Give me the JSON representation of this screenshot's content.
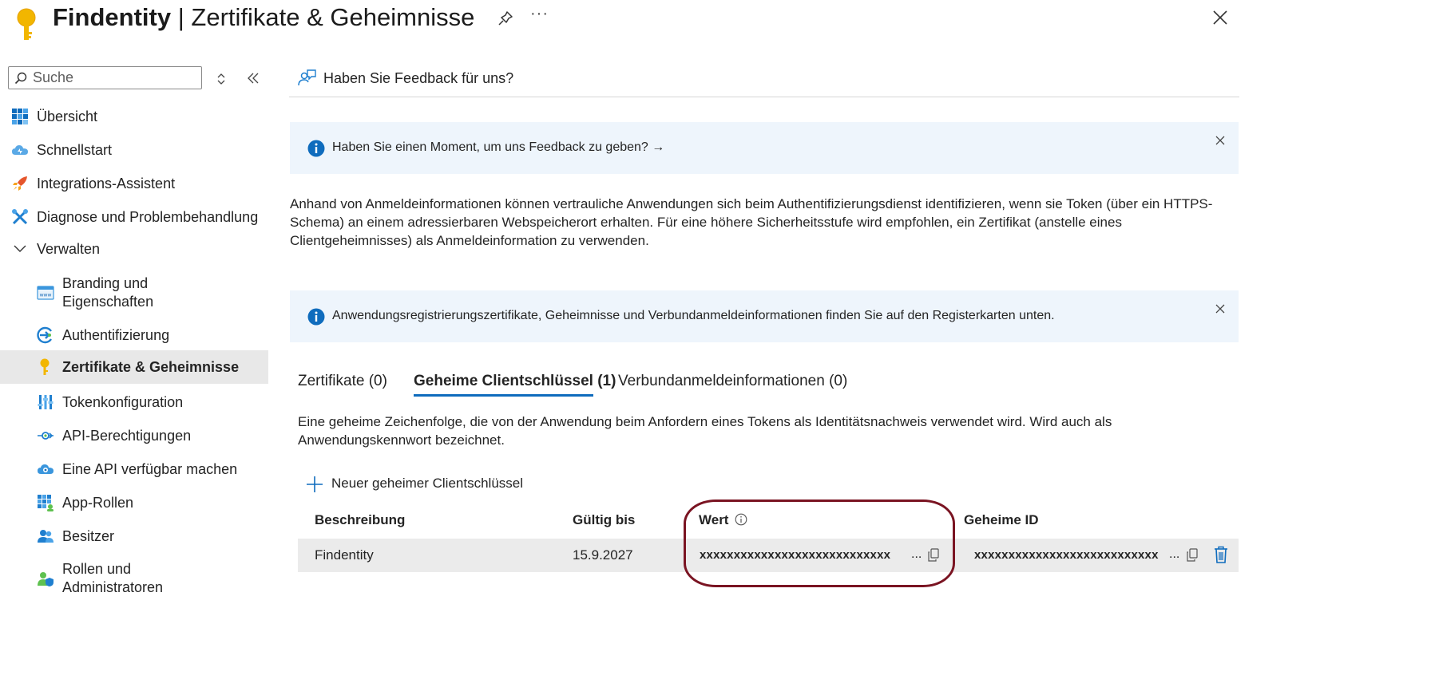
{
  "header": {
    "app_name": "Findentity",
    "separator": "|",
    "page_title": "Zertifikate & Geheimnisse",
    "more_label": "···"
  },
  "sidebar": {
    "search_placeholder": "Suche",
    "items": [
      {
        "label": "Übersicht",
        "icon": "grid-icon"
      },
      {
        "label": "Schnellstart",
        "icon": "cloud-icon"
      },
      {
        "label": "Integrations-Assistent",
        "icon": "rocket-icon"
      },
      {
        "label": "Diagnose und Problembehandlung",
        "icon": "wrench-icon"
      },
      {
        "label": "Verwalten",
        "icon": "chevron-down-icon"
      },
      {
        "label": "Branding und Eigenschaften",
        "icon": "www-icon"
      },
      {
        "label": "Authentifizierung",
        "icon": "auth-icon"
      },
      {
        "label": "Zertifikate & Geheimnisse",
        "icon": "key-icon"
      },
      {
        "label": "Tokenkonfiguration",
        "icon": "bars-icon"
      },
      {
        "label": "API-Berechtigungen",
        "icon": "api-icon"
      },
      {
        "label": "Eine API verfügbar machen",
        "icon": "cloud-api-icon"
      },
      {
        "label": "App-Rollen",
        "icon": "app-roles-icon"
      },
      {
        "label": "Besitzer",
        "icon": "owners-icon"
      },
      {
        "label": "Rollen und Administratoren",
        "icon": "admin-icon"
      }
    ]
  },
  "main": {
    "feedback_link": "Haben Sie Feedback für uns?",
    "banner1_text": "Haben Sie einen Moment, um uns Feedback zu geben? →",
    "description": "Anhand von Anmeldeinformationen können vertrauliche Anwendungen sich beim Authentifizierungsdienst identifizieren, wenn sie Token (über ein HTTPS-Schema) an einem adressierbaren Webspeicherort erhalten. Für eine höhere Sicherheitsstufe wird empfohlen, ein Zertifikat (anstelle eines Clientgeheimnisses) als Anmeldeinformation zu verwenden.",
    "banner2_text": "Anwendungsregistrierungszertifikate, Geheimnisse und Verbundanmeldeinformationen finden Sie auf den Registerkarten unten.",
    "tabs": [
      {
        "label": "Zertifikate (0)",
        "active": false
      },
      {
        "label": "Geheime Clientschlüssel (1)",
        "active": true
      },
      {
        "label": "Verbundanmeldeinformationen (0)",
        "active": false
      }
    ],
    "secret_description": "Eine geheime Zeichenfolge, die von der Anwendung beim Anfordern eines Tokens als Identitätsnachweis verwendet wird. Wird auch als Anwendungskennwort bezeichnet.",
    "add_button": "Neuer geheimer Clientschlüssel",
    "table": {
      "headers": [
        "Beschreibung",
        "Gültig bis",
        "Wert",
        "Geheime ID"
      ],
      "rows": [
        {
          "description": "Findentity",
          "expires": "15.9.2027",
          "value": "xxxxxxxxxxxxxxxxxxxxxxxxxxxx",
          "secret_id": "xxxxxxxxxxxxxxxxxxxxxxxxxxx",
          "ellipsis": "..."
        }
      ]
    }
  },
  "colors": {
    "accent": "#0f6cbd",
    "highlight": "#7a1422",
    "banner_bg": "#eef5fc",
    "active_row": "#e8e8e8"
  }
}
